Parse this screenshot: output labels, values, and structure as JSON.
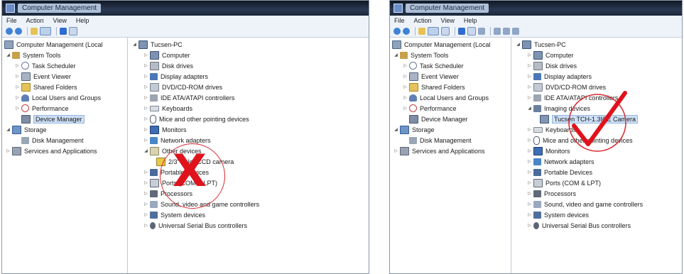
{
  "left_window": {
    "title": "Computer Management",
    "menu": [
      "File",
      "Action",
      "View",
      "Help"
    ],
    "tree": [
      {
        "label": "Computer Management (Local",
        "icon": "computer-icon",
        "toggle": ""
      },
      {
        "label": "System Tools",
        "icon": "tools-icon",
        "toggle": "◢"
      },
      {
        "label": "Task Scheduler",
        "icon": "clock-icon",
        "toggle": "▷"
      },
      {
        "label": "Event Viewer",
        "icon": "event-viewer-icon",
        "toggle": "▷"
      },
      {
        "label": "Shared Folders",
        "icon": "folder-icon",
        "toggle": "▷"
      },
      {
        "label": "Local Users and Groups",
        "icon": "users-icon",
        "toggle": "▷"
      },
      {
        "label": "Performance",
        "icon": "performance-icon",
        "toggle": "▷"
      },
      {
        "label": "Device Manager",
        "icon": "device-manager-icon",
        "toggle": ""
      },
      {
        "label": "Storage",
        "icon": "storage-icon",
        "toggle": "◢"
      },
      {
        "label": "Disk Management",
        "icon": "disk-icon",
        "toggle": ""
      },
      {
        "label": "Services and Applications",
        "icon": "services-icon",
        "toggle": "▷"
      }
    ],
    "devices_root": "Tucsen-PC",
    "devices": [
      {
        "label": "Computer",
        "icon": "computer-icon"
      },
      {
        "label": "Disk drives",
        "icon": "disk-drive-icon"
      },
      {
        "label": "Display adapters",
        "icon": "display-adapter-icon"
      },
      {
        "label": "DVD/CD-ROM drives",
        "icon": "dvd-icon"
      },
      {
        "label": "IDE ATA/ATAPI controllers",
        "icon": "ide-icon"
      },
      {
        "label": "Keyboards",
        "icon": "keyboard-icon"
      },
      {
        "label": "Mice and other pointing devices",
        "icon": "mouse-icon"
      },
      {
        "label": "Monitors",
        "icon": "monitor-icon"
      },
      {
        "label": "Network adapters",
        "icon": "network-icon"
      },
      {
        "label": "Other devices",
        "icon": "other-devices-icon"
      },
      {
        "label": "2/3\" color CCD camera",
        "icon": "unknown-device-warning-icon"
      },
      {
        "label": "Portable Devices",
        "icon": "portable-device-icon"
      },
      {
        "label": "Ports (COM & LPT)",
        "icon": "port-icon"
      },
      {
        "label": "Processors",
        "icon": "processor-icon"
      },
      {
        "label": "Sound, video and game controllers",
        "icon": "sound-icon"
      },
      {
        "label": "System devices",
        "icon": "system-device-icon"
      },
      {
        "label": "Universal Serial Bus controllers",
        "icon": "usb-icon"
      }
    ],
    "mark": "X",
    "mark_color": "#e0121b"
  },
  "right_window": {
    "title": "Computer Management",
    "menu": [
      "File",
      "Action",
      "View",
      "Help"
    ],
    "tree": [
      {
        "label": "Computer Management (Local",
        "icon": "computer-icon",
        "toggle": ""
      },
      {
        "label": "System Tools",
        "icon": "tools-icon",
        "toggle": "◢"
      },
      {
        "label": "Task Scheduler",
        "icon": "clock-icon",
        "toggle": "▷"
      },
      {
        "label": "Event Viewer",
        "icon": "event-viewer-icon",
        "toggle": "▷"
      },
      {
        "label": "Shared Folders",
        "icon": "folder-icon",
        "toggle": "▷"
      },
      {
        "label": "Local Users and Groups",
        "icon": "users-icon",
        "toggle": "▷"
      },
      {
        "label": "Performance",
        "icon": "performance-icon",
        "toggle": "▷"
      },
      {
        "label": "Device Manager",
        "icon": "device-manager-icon",
        "toggle": ""
      },
      {
        "label": "Storage",
        "icon": "storage-icon",
        "toggle": "◢"
      },
      {
        "label": "Disk Management",
        "icon": "disk-icon",
        "toggle": ""
      },
      {
        "label": "Services and Applications",
        "icon": "services-icon",
        "toggle": "▷"
      }
    ],
    "devices_root": "Tucsen-PC",
    "devices": [
      {
        "label": "Computer",
        "icon": "computer-icon"
      },
      {
        "label": "Disk drives",
        "icon": "disk-drive-icon"
      },
      {
        "label": "Display adapters",
        "icon": "display-adapter-icon"
      },
      {
        "label": "DVD/CD-ROM drives",
        "icon": "dvd-icon"
      },
      {
        "label": "IDE ATA/ATAPI controllers",
        "icon": "ide-icon"
      },
      {
        "label": "Imaging devices",
        "icon": "imaging-device-icon"
      },
      {
        "label": "Tucsen TCH-1.3ICE Camera",
        "icon": "camera-icon"
      },
      {
        "label": "Keyboards",
        "icon": "keyboard-icon"
      },
      {
        "label": "Mice and other pointing devices",
        "icon": "mouse-icon"
      },
      {
        "label": "Monitors",
        "icon": "monitor-icon"
      },
      {
        "label": "Network adapters",
        "icon": "network-icon"
      },
      {
        "label": "Portable Devices",
        "icon": "portable-device-icon"
      },
      {
        "label": "Ports (COM & LPT)",
        "icon": "port-icon"
      },
      {
        "label": "Processors",
        "icon": "processor-icon"
      },
      {
        "label": "Sound, video and game controllers",
        "icon": "sound-icon"
      },
      {
        "label": "System devices",
        "icon": "system-device-icon"
      },
      {
        "label": "Universal Serial Bus controllers",
        "icon": "usb-icon"
      }
    ],
    "mark_color": "#e0121b"
  }
}
